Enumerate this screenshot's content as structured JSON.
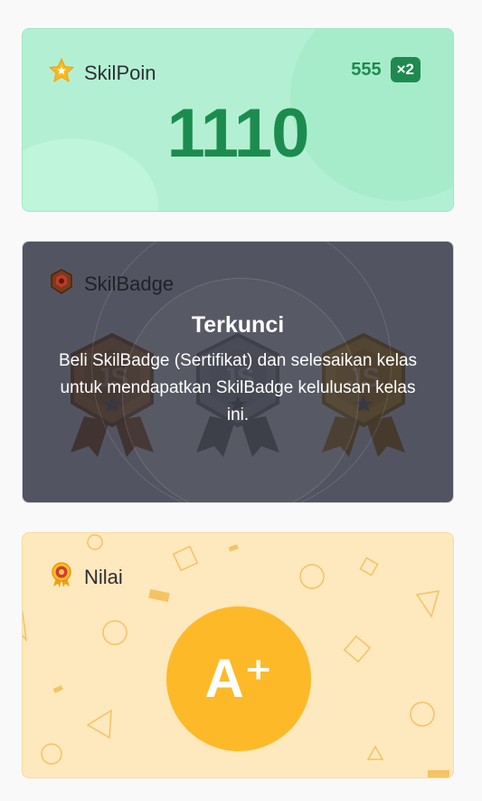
{
  "points_card": {
    "title": "SkilPoin",
    "raw_points": "555",
    "multiplier": "×2",
    "total": "1110"
  },
  "badge_card": {
    "title": "SkilBadge",
    "locked_title": "Terkunci",
    "locked_message": "Beli SkilBadge (Sertifikat) dan selesaikan kelas untuk mendapatkan SkilBadge kelulusan kelas ini.",
    "badges": [
      {
        "tier": "bronze",
        "label": "JS",
        "color": "#c87a2c"
      },
      {
        "tier": "silver",
        "label": "JS",
        "color": "#a9a9a9"
      },
      {
        "tier": "gold",
        "label": "JS",
        "color": "#e6a21a"
      }
    ]
  },
  "grade_card": {
    "title": "Nilai",
    "grade": "A⁺"
  },
  "colors": {
    "points_bg": "#b3f0d3",
    "points_accent": "#1c8c4e",
    "grade_bg": "#fee8bd",
    "grade_accent": "#fdb928"
  }
}
